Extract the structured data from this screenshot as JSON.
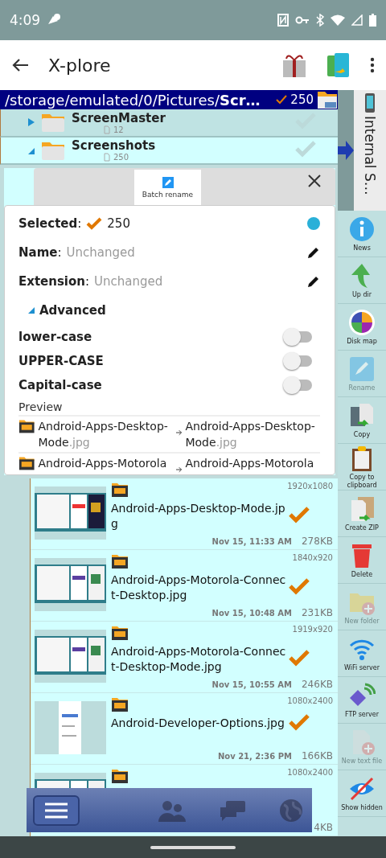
{
  "status_bar": {
    "time": "4:09"
  },
  "app_bar": {
    "title": "X-plore"
  },
  "path_bar": {
    "path": "/storage/emulated/0/Pictures/**Scr…**",
    "count": "250"
  },
  "folders": [
    {
      "name": "ScreenMaster",
      "count": "12",
      "expanded": false,
      "checked": false
    },
    {
      "name": "Screenshots",
      "count": "250",
      "expanded": true,
      "checked": false
    }
  ],
  "dialog": {
    "tab": "Batch rename",
    "selected_label": "**Selected**:",
    "selected_count": "250",
    "fields": [
      {
        "label": "**Name**:",
        "value": "Unchanged"
      },
      {
        "label": "**Extension**:",
        "value": "Unchanged"
      }
    ],
    "advanced": {
      "label": "Advanced",
      "expanded": true
    },
    "options": [
      {
        "label": "lower-case",
        "on": false
      },
      {
        "label": "UPPER-CASE",
        "on": false
      },
      {
        "label": "Capital-case",
        "on": false
      }
    ],
    "preview_label": "Preview",
    "preview": [
      {
        "from": "Android-Apps-Desktop-Mode",
        "from_ext": ".jpg",
        "to": "Android-Apps-Desktop-Mode",
        "to_ext": ".jpg"
      },
      {
        "from": "Android-Apps-Motorola",
        "to": "Android-Apps-Motorola"
      }
    ]
  },
  "files": [
    {
      "name": "Android-Apps-Desktop-Mode.jpg",
      "dims": "1920x1080",
      "date": "Nov 15, 11:33 AM",
      "size": "278KB",
      "checked": true
    },
    {
      "name": "Android-Apps-Motorola-Connect-Desktop.jpg",
      "dims": "1840x920",
      "date": "Nov 15, 10:48 AM",
      "size": "231KB",
      "checked": true
    },
    {
      "name": "Android-Apps-Motorola-Connect-Desktop-Mode.jpg",
      "dims": "1919x920",
      "date": "Nov 15, 10:55 AM",
      "size": "246KB",
      "checked": true
    },
    {
      "name": "Android-Developer-Options.jpg",
      "dims": "1080x2400",
      "date": "Nov 21, 2:36 PM",
      "size": "166KB",
      "checked": true
    },
    {
      "dims": "1080x2400",
      "size": "4KB"
    }
  ],
  "bottom_toolbar": [
    {
      "kind": "menu",
      "selected": true
    },
    {
      "kind": "people",
      "selected": false
    },
    {
      "kind": "chat",
      "selected": false
    },
    {
      "kind": "globe",
      "selected": false
    }
  ],
  "sidebar": {
    "storage": "Internal S…",
    "tools": [
      {
        "kind": "news",
        "label": "News",
        "disabled": false
      },
      {
        "kind": "updir",
        "label": "Up dir",
        "disabled": false
      },
      {
        "kind": "diskmap",
        "label": "Disk map",
        "disabled": false
      },
      {
        "kind": "rename",
        "label": "Rename",
        "disabled": true
      },
      {
        "kind": "copy",
        "label": "Copy",
        "disabled": false
      },
      {
        "kind": "clipboard",
        "label": "Copy to clipboard",
        "disabled": false
      },
      {
        "kind": "zip",
        "label": "Create ZIP",
        "disabled": false
      },
      {
        "kind": "delete",
        "label": "Delete",
        "disabled": false
      },
      {
        "kind": "newfolder",
        "label": "New folder",
        "disabled": true
      },
      {
        "kind": "wifi",
        "label": "WiFi server",
        "disabled": false
      },
      {
        "kind": "ftp",
        "label": "FTP server",
        "disabled": false
      },
      {
        "kind": "newtext",
        "label": "New text file",
        "disabled": true
      },
      {
        "kind": "hidden",
        "label": "Show hidden",
        "disabled": false
      }
    ]
  }
}
